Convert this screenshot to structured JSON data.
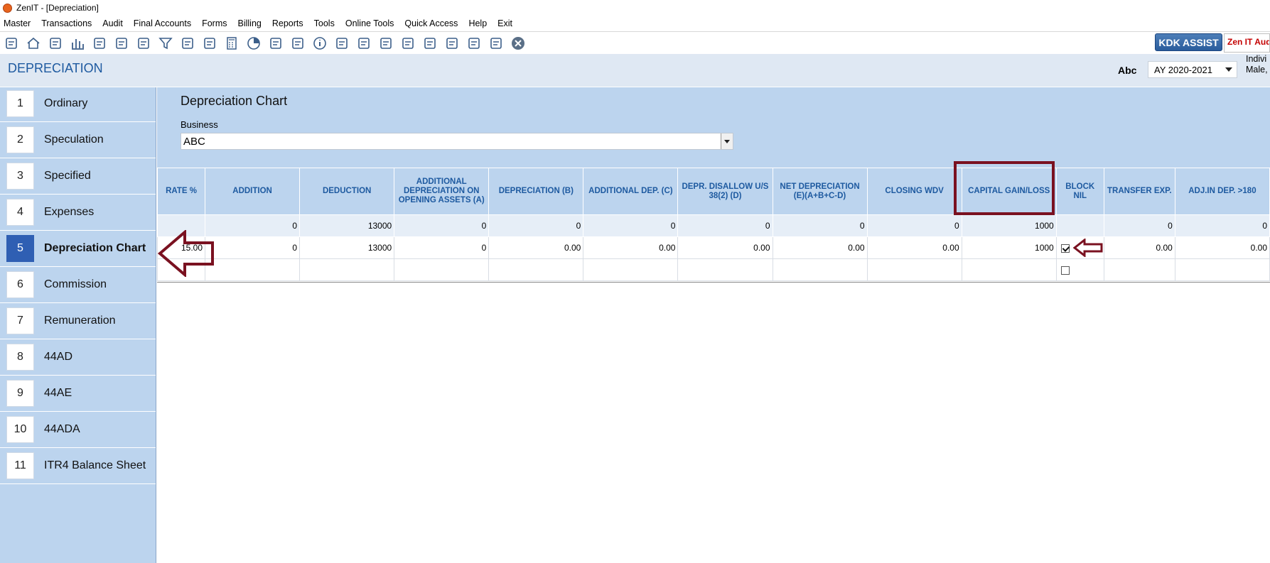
{
  "window": {
    "title": "ZenIT - [Depreciation]"
  },
  "menu": [
    "Master",
    "Transactions",
    "Audit",
    "Final Accounts",
    "Forms",
    "Billing",
    "Reports",
    "Tools",
    "Online Tools",
    "Quick Access",
    "Help",
    "Exit"
  ],
  "toolbar": {
    "icons": [
      "rupee-icon",
      "home-icon",
      "building-icon",
      "bar-chart-icon",
      "gift-icon",
      "users-icon",
      "hammer-icon",
      "funnel-icon",
      "tax-icon",
      "pay-icon",
      "calculator-icon",
      "pie-icon",
      "e-pay-icon",
      "book-icon",
      "info-icon",
      "report-icon",
      "calendar-icon",
      "doc-add-icon",
      "doc-search-icon",
      "bs-icon",
      "bs2-icon",
      "3cd-icon",
      "form-icon",
      "close-circle-icon"
    ],
    "kdk_label": "KDK ASSIST",
    "zen_label": "Zen IT Audit"
  },
  "header": {
    "title": "DEPRECIATION",
    "assessee_name": "Abc",
    "ay_value": "AY 2020-2021",
    "assessee_type_line1": "Indivi",
    "assessee_type_line2": "Male,"
  },
  "sidebar": {
    "items": [
      {
        "num": "1",
        "label": "Ordinary"
      },
      {
        "num": "2",
        "label": "Speculation"
      },
      {
        "num": "3",
        "label": "Specified"
      },
      {
        "num": "4",
        "label": "Expenses"
      },
      {
        "num": "5",
        "label": "Depreciation Chart"
      },
      {
        "num": "6",
        "label": "Commission"
      },
      {
        "num": "7",
        "label": "Remuneration"
      },
      {
        "num": "8",
        "label": "44AD"
      },
      {
        "num": "9",
        "label": "44AE"
      },
      {
        "num": "10",
        "label": "44ADA"
      },
      {
        "num": "11",
        "label": "ITR4 Balance Sheet"
      }
    ],
    "active_index": 4
  },
  "main": {
    "title": "Depreciation Chart",
    "business_label": "Business",
    "business_value": "ABC"
  },
  "grid": {
    "columns": [
      "RATE %",
      "ADDITION",
      "DEDUCTION",
      "ADDITIONAL DEPRECIATION ON OPENING ASSETS (A)",
      "DEPRECIATION (B)",
      "ADDITIONAL DEP. (C)",
      "DEPR. DISALLOW U/S 38(2) (D)",
      "NET DEPRECIATION (E)(A+B+C-D)",
      "CLOSING WDV",
      "CAPITAL GAIN/LOSS",
      "BLOCK NIL",
      "TRANSFER EXP.",
      "ADJ.IN DEP. >180"
    ],
    "totals": [
      "",
      "0",
      "13000",
      "0",
      "0",
      "0",
      "0",
      "0",
      "0",
      "1000",
      "",
      "0",
      "0"
    ],
    "rows": [
      {
        "cells": [
          "15.00",
          "0",
          "13000",
          "0",
          "0.00",
          "0.00",
          "0.00",
          "0.00",
          "0.00",
          "1000",
          "",
          "0.00",
          "0.00"
        ],
        "block_nil": true
      }
    ],
    "empty_row_block_nil": false
  }
}
